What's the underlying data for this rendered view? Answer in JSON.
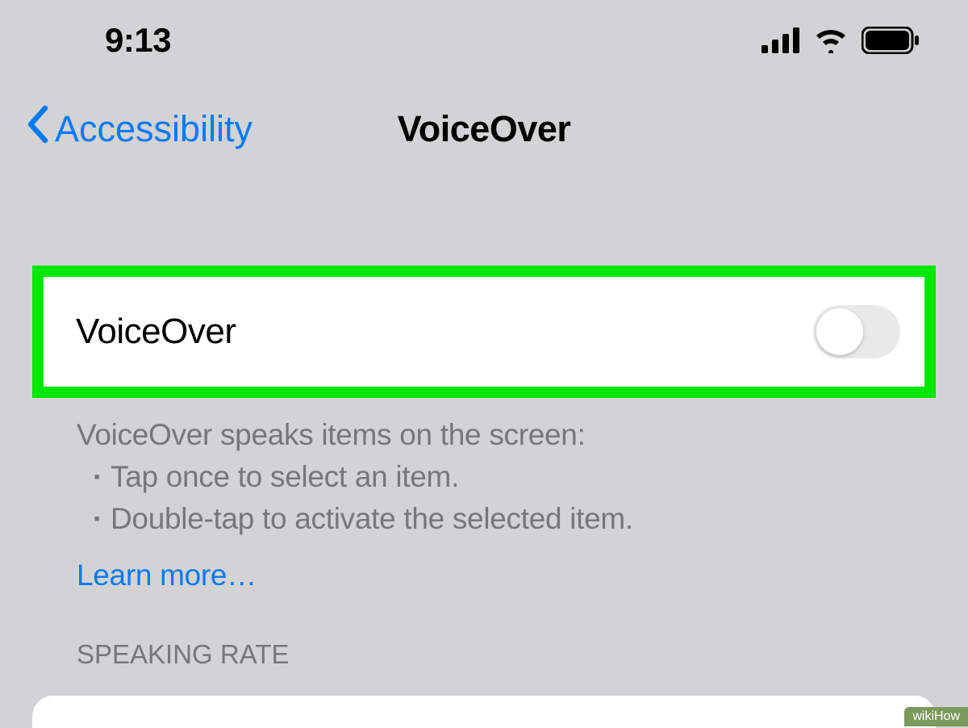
{
  "status_bar": {
    "time": "9:13"
  },
  "nav": {
    "back_label": "Accessibility",
    "title": "VoiceOver"
  },
  "toggle": {
    "label": "VoiceOver",
    "enabled": false
  },
  "description": {
    "heading": "VoiceOver speaks items on the screen:",
    "bullets": [
      "Tap once to select an item.",
      "Double-tap to activate the selected item."
    ],
    "learn_more": "Learn more…"
  },
  "sections": {
    "speaking_rate": "SPEAKING RATE"
  },
  "watermark": "wikiHow"
}
